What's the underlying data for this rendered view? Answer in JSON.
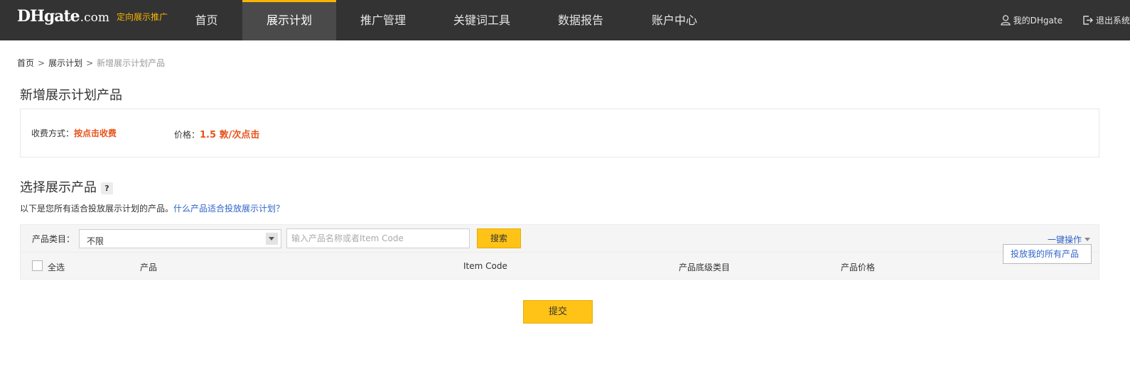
{
  "header": {
    "logo_main": "DHgate",
    "logo_com": ".com",
    "logo_sub": "定向展示推广",
    "nav": [
      {
        "label": "首页",
        "active": false
      },
      {
        "label": "展示计划",
        "active": true
      },
      {
        "label": "推广管理",
        "active": false
      },
      {
        "label": "关键词工具",
        "active": false
      },
      {
        "label": "数据报告",
        "active": false
      },
      {
        "label": "账户中心",
        "active": false
      }
    ],
    "my_dhgate": "我的DHgate",
    "logout": "退出系统"
  },
  "breadcrumb": {
    "home": "首页",
    "sep": ">",
    "plan": "展示计划",
    "current": "新增展示计划产品"
  },
  "page_title": "新增展示计划产品",
  "fee": {
    "method_label": "收费方式：",
    "method_value": "按点击收费",
    "price_label": "价格：",
    "price_value": "1.5 敦/次点击"
  },
  "select_section": {
    "title": "选择展示产品",
    "help": "?",
    "desc": "以下是您所有适合投放展示计划的产品。",
    "desc_link": "什么产品适合投放展示计划？"
  },
  "filter": {
    "category_label": "产品类目：",
    "category_value": "不限",
    "search_placeholder": "输入产品名称或者Item Code",
    "search_button": "搜索",
    "onekey": "一键操作",
    "onekey_option": "投放我的所有产品"
  },
  "table": {
    "select_all": "全选",
    "columns": [
      "产品",
      "Item Code",
      "产品底级类目",
      "产品价格"
    ]
  },
  "submit": "提交",
  "colors": {
    "header_bg": "#333333",
    "accent": "#ffc317",
    "price": "#e8531b",
    "link": "#2f63c8"
  }
}
